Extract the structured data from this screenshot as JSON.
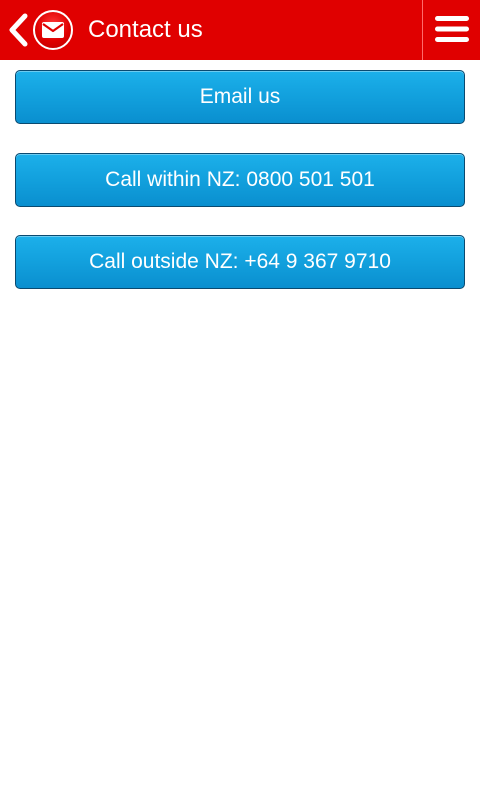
{
  "header": {
    "title": "Contact us",
    "back_icon": "chevron-left-icon",
    "logo_icon": "envelope-icon",
    "menu_icon": "hamburger-menu-icon",
    "bar_color": "#e00000"
  },
  "actions": {
    "email_label": "Email us",
    "call_nz_label": "Call within NZ: 0800 501 501",
    "call_intl_label": "Call outside NZ: +64 9 367 9710",
    "button_color": "#12a0dd"
  }
}
